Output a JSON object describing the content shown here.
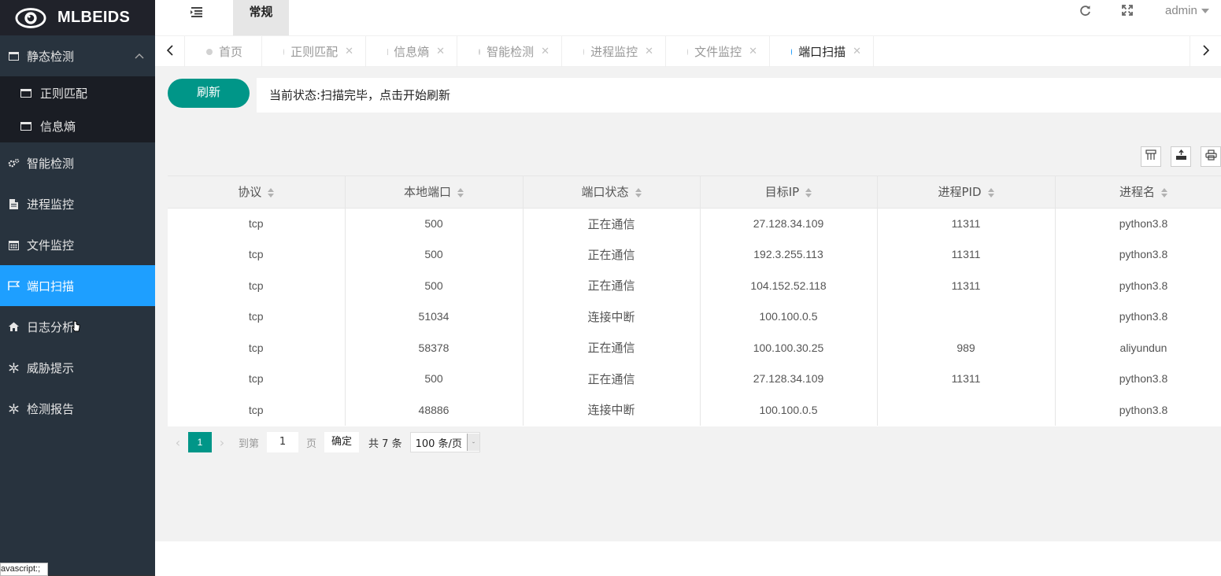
{
  "brand": {
    "name": "MLBEIDS"
  },
  "sidebar": {
    "groups": [
      {
        "label": "静态检测",
        "icon": "window-icon",
        "expanded": true,
        "children": [
          {
            "label": "正则匹配",
            "icon": "window-icon"
          },
          {
            "label": "信息熵",
            "icon": "window-icon"
          }
        ]
      }
    ],
    "items": [
      {
        "label": "智能检测",
        "icon": "gears-icon"
      },
      {
        "label": "进程监控",
        "icon": "document-icon"
      },
      {
        "label": "文件监控",
        "icon": "calendar-icon"
      },
      {
        "label": "端口扫描",
        "icon": "flag-icon",
        "active": true
      },
      {
        "label": "日志分析",
        "icon": "home-icon"
      },
      {
        "label": "威胁提示",
        "icon": "snowflake-icon"
      },
      {
        "label": "检测报告",
        "icon": "snowflake-icon"
      }
    ]
  },
  "header": {
    "tab_label": "常规",
    "user": "admin"
  },
  "tabs": [
    {
      "label": "首页",
      "closable": false,
      "active": false
    },
    {
      "label": "正则匹配",
      "closable": true,
      "active": false
    },
    {
      "label": "信息熵",
      "closable": true,
      "active": false
    },
    {
      "label": "智能检测",
      "closable": true,
      "active": false
    },
    {
      "label": "进程监控",
      "closable": true,
      "active": false
    },
    {
      "label": "文件监控",
      "closable": true,
      "active": false
    },
    {
      "label": "端口扫描",
      "closable": true,
      "active": true
    }
  ],
  "controls": {
    "refresh_label": "刷新",
    "status_text": "当前状态:扫描完毕，点击开始刷新"
  },
  "table": {
    "columns": [
      "协议",
      "本地端口",
      "端口状态",
      "目标IP",
      "进程PID",
      "进程名"
    ],
    "rows": [
      [
        "tcp",
        "500",
        "正在通信",
        "27.128.34.109",
        "11311",
        "python3.8"
      ],
      [
        "tcp",
        "500",
        "正在通信",
        "192.3.255.113",
        "11311",
        "python3.8"
      ],
      [
        "tcp",
        "500",
        "正在通信",
        "104.152.52.118",
        "11311",
        "python3.8"
      ],
      [
        "tcp",
        "51034",
        "连接中断",
        "100.100.0.5",
        "",
        "python3.8"
      ],
      [
        "tcp",
        "58378",
        "正在通信",
        "100.100.30.25",
        "989",
        "aliyundun"
      ],
      [
        "tcp",
        "500",
        "正在通信",
        "27.128.34.109",
        "11311",
        "python3.8"
      ],
      [
        "tcp",
        "48886",
        "连接中断",
        "100.100.0.5",
        "",
        "python3.8"
      ]
    ]
  },
  "pager": {
    "current_page": "1",
    "goto_prefix": "到第",
    "goto_value": "1",
    "goto_suffix": "页",
    "confirm_label": "确定",
    "total_text": "共 7 条",
    "page_size": "100 条/页"
  },
  "statusbar": {
    "text": "avascript:;"
  },
  "colors": {
    "sidebar_bg": "#28333e",
    "active_blue": "#1e9fff",
    "teal": "#009688"
  }
}
